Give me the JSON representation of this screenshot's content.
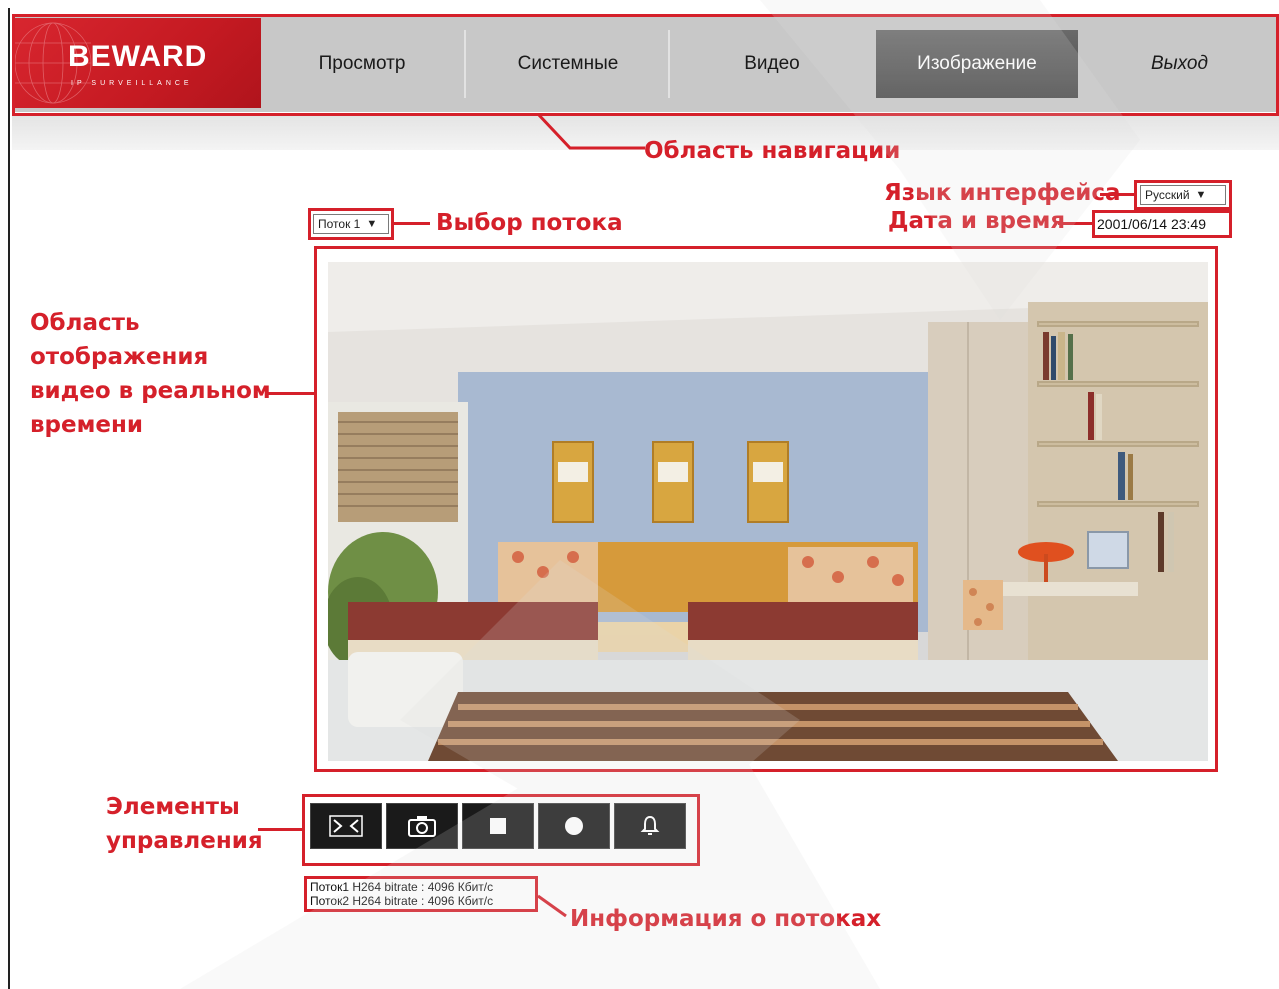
{
  "logo": {
    "brand": "BEWARD",
    "tagline": "IP SURVEILLANCE"
  },
  "nav": {
    "tabs": [
      "Просмотр",
      "Системные",
      "Видео",
      "Изображение",
      "Выход"
    ],
    "active": "Изображение"
  },
  "stream_select": {
    "value": "Поток 1"
  },
  "language_select": {
    "value": "Русский"
  },
  "datetime": "2001/06/14 23:49",
  "stream_info": [
    "Поток1 H264 bitrate : 4096 Кбит/с",
    "Поток2 H264 bitrate : 4096 Кбит/с"
  ],
  "controls": [
    "fullscreen-icon",
    "camera-snapshot-icon",
    "stop-icon",
    "record-icon",
    "alarm-bell-icon"
  ],
  "annotations": {
    "navigation": "Область навигации",
    "language": "Язык интерфейса",
    "datetime": "Дата и время",
    "stream_select": "Выбор потока",
    "video_area": [
      "Область",
      "отображения",
      "видео в реальном",
      "времени"
    ],
    "controls": [
      "Элементы",
      "управления"
    ],
    "stream_info": "Информация о потоках"
  },
  "colors": {
    "annotation": "#d5202a",
    "active_tab": "#555555",
    "nav_bar": "#c8c8c8"
  }
}
